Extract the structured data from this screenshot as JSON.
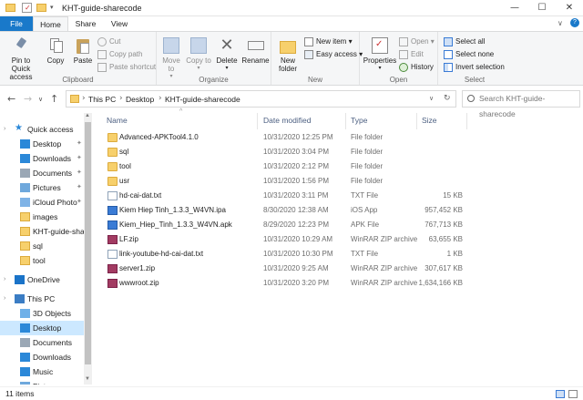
{
  "window": {
    "title": "KHT-guide-sharecode",
    "minimize": "—",
    "maximize": "☐",
    "close": "✕"
  },
  "tabs": {
    "file": "File",
    "home": "Home",
    "share": "Share",
    "view": "View"
  },
  "ribbon": {
    "clipboard": {
      "label": "Clipboard",
      "pin": "Pin to Quick access",
      "copy": "Copy",
      "paste": "Paste",
      "cut": "Cut",
      "copy_path": "Copy path",
      "paste_shortcut": "Paste shortcut"
    },
    "organize": {
      "label": "Organize",
      "move_to": "Move to",
      "copy_to": "Copy to",
      "delete": "Delete",
      "rename": "Rename"
    },
    "new": {
      "label": "New",
      "new_folder": "New folder",
      "new_item": "New item",
      "easy_access": "Easy access"
    },
    "open": {
      "label": "Open",
      "properties": "Properties",
      "open": "Open",
      "edit": "Edit",
      "history": "History"
    },
    "select": {
      "label": "Select",
      "select_all": "Select all",
      "select_none": "Select none",
      "invert": "Invert selection"
    }
  },
  "address": {
    "crumbs": [
      "This PC",
      "Desktop",
      "KHT-guide-sharecode"
    ],
    "search_placeholder": "Search KHT-guide-sharecode"
  },
  "nav": [
    {
      "label": "Quick access",
      "icon": "star-icon",
      "pinned": false
    },
    {
      "label": "Desktop",
      "icon": "desktop-icon",
      "pinned": true
    },
    {
      "label": "Downloads",
      "icon": "download-icon",
      "pinned": true
    },
    {
      "label": "Documents",
      "icon": "documents-icon",
      "pinned": true
    },
    {
      "label": "Pictures",
      "icon": "pictures-icon",
      "pinned": true
    },
    {
      "label": "iCloud Photo",
      "icon": "icloud-icon",
      "pinned": true
    },
    {
      "label": "images",
      "icon": "folder-icon",
      "pinned": false
    },
    {
      "label": "KHT-guide-sharec",
      "icon": "folder-icon",
      "pinned": false
    },
    {
      "label": "sql",
      "icon": "folder-icon",
      "pinned": false
    },
    {
      "label": "tool",
      "icon": "folder-icon",
      "pinned": false
    },
    {
      "label": "OneDrive",
      "icon": "onedrive-icon",
      "pinned": false
    },
    {
      "label": "This PC",
      "icon": "pc-icon",
      "pinned": false
    },
    {
      "label": "3D Objects",
      "icon": "3d-objects-icon",
      "pinned": false
    },
    {
      "label": "Desktop",
      "icon": "desktop-icon",
      "pinned": false
    },
    {
      "label": "Documents",
      "icon": "documents-icon",
      "pinned": false
    },
    {
      "label": "Downloads",
      "icon": "download-icon",
      "pinned": false
    },
    {
      "label": "Music",
      "icon": "music-icon",
      "pinned": false
    },
    {
      "label": "Pictures",
      "icon": "pictures-icon",
      "pinned": false
    }
  ],
  "columns": {
    "name": "Name",
    "date": "Date modified",
    "type": "Type",
    "size": "Size"
  },
  "files": [
    {
      "name": "Advanced-APKTool4.1.0",
      "date": "10/31/2020 12:25 PM",
      "type": "File folder",
      "size": "",
      "icon": "folder-icon"
    },
    {
      "name": "sql",
      "date": "10/31/2020 3:04 PM",
      "type": "File folder",
      "size": "",
      "icon": "folder-icon"
    },
    {
      "name": "tool",
      "date": "10/31/2020 2:12 PM",
      "type": "File folder",
      "size": "",
      "icon": "folder-icon"
    },
    {
      "name": "usr",
      "date": "10/31/2020 1:56 PM",
      "type": "File folder",
      "size": "",
      "icon": "folder-icon"
    },
    {
      "name": "hd-cai-dat.txt",
      "date": "10/31/2020 3:11 PM",
      "type": "TXT File",
      "size": "15 KB",
      "icon": "txt-file-icon"
    },
    {
      "name": "Kiem Hiep Tinh_1.3.3_W4VN.ipa",
      "date": "8/30/2020 12:38 AM",
      "type": "iOS App",
      "size": "957,452 KB",
      "icon": "ipa-file-icon"
    },
    {
      "name": "Kiem_Hiep_Tinh_1.3.3_W4VN.apk",
      "date": "8/29/2020 12:23 PM",
      "type": "APK File",
      "size": "767,713 KB",
      "icon": "apk-file-icon"
    },
    {
      "name": "LF.zip",
      "date": "10/31/2020 10:29 AM",
      "type": "WinRAR ZIP archive",
      "size": "63,655 KB",
      "icon": "zip-file-icon"
    },
    {
      "name": "link-youtube-hd-cai-dat.txt",
      "date": "10/31/2020 10:30 PM",
      "type": "TXT File",
      "size": "1 KB",
      "icon": "txt-file-icon"
    },
    {
      "name": "server1.zip",
      "date": "10/31/2020 9:25 AM",
      "type": "WinRAR ZIP archive",
      "size": "307,617 KB",
      "icon": "zip-file-icon"
    },
    {
      "name": "wwwroot.zip",
      "date": "10/31/2020 3:20 PM",
      "type": "WinRAR ZIP archive",
      "size": "1,634,166 KB",
      "icon": "zip-file-icon"
    }
  ],
  "status": {
    "count": "11 items"
  }
}
